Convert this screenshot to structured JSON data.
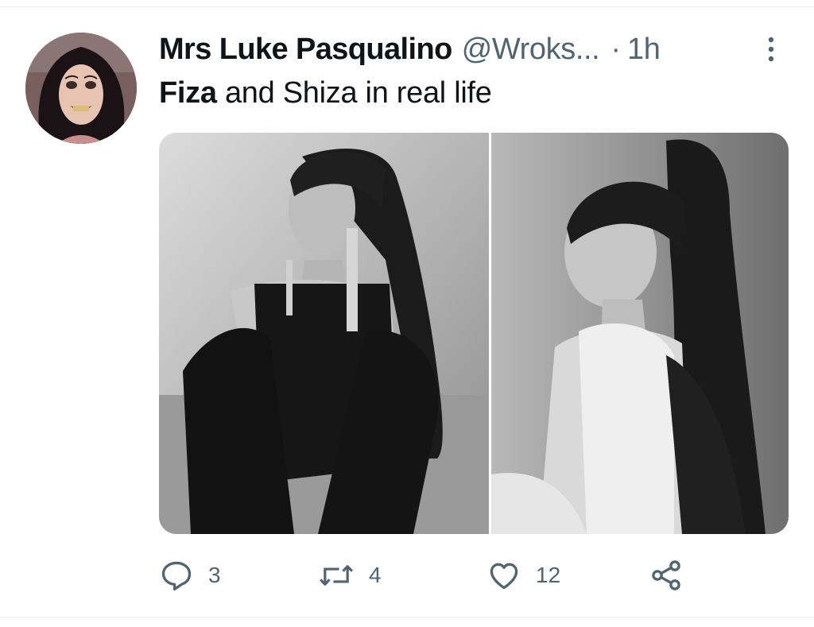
{
  "tweet": {
    "author": {
      "display_name": "Mrs Luke Pasqualino",
      "handle": "@Wroks...",
      "avatar_icon": "profile-photo"
    },
    "separator": "·",
    "time": "1h",
    "text": {
      "bold_part": "Fiza",
      "rest": " and Shiza in real life"
    },
    "media": [
      {
        "icon": "photo-bw-woman-ponytail-earrings"
      },
      {
        "icon": "photo-bw-woman-high-ponytail"
      }
    ],
    "actions": {
      "reply": {
        "icon": "reply-icon",
        "count": "3"
      },
      "retweet": {
        "icon": "retweet-icon",
        "count": "4"
      },
      "like": {
        "icon": "heart-icon",
        "count": "12"
      },
      "share": {
        "icon": "share-icon"
      }
    }
  },
  "colors": {
    "text_primary": "#0f1419",
    "text_secondary": "#536471",
    "divider": "#e6ecf0"
  }
}
